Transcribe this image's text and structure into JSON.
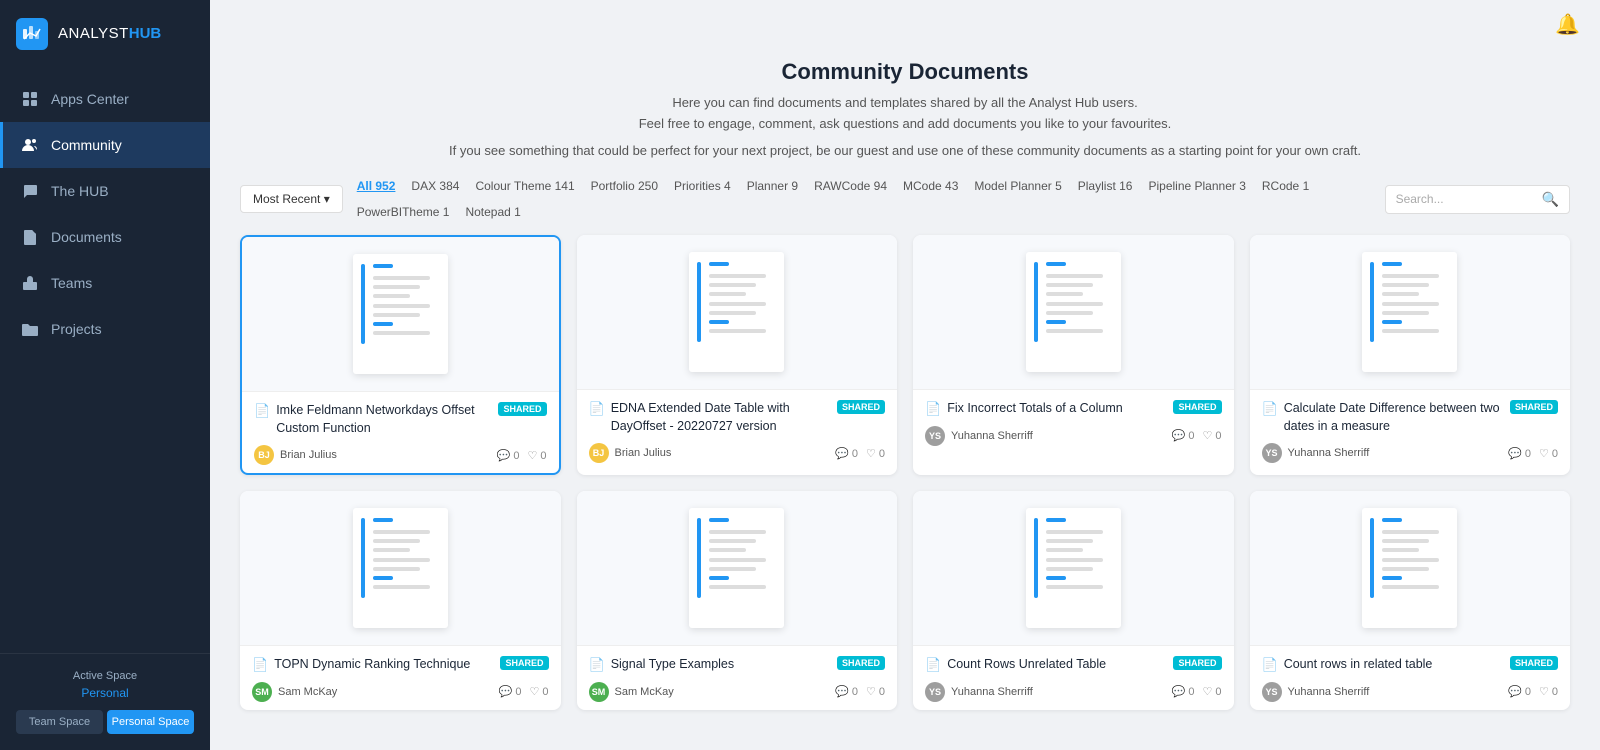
{
  "sidebar": {
    "logo": {
      "text_analyst": "ANALYST",
      "text_hub": "HUB"
    },
    "items": [
      {
        "id": "apps-center",
        "label": "Apps Center",
        "icon": "grid"
      },
      {
        "id": "community",
        "label": "Community",
        "icon": "users",
        "active": true
      },
      {
        "id": "the-hub",
        "label": "The HUB",
        "icon": "chat"
      },
      {
        "id": "documents",
        "label": "Documents",
        "icon": "doc"
      },
      {
        "id": "teams",
        "label": "Teams",
        "icon": "team"
      },
      {
        "id": "projects",
        "label": "Projects",
        "icon": "folder"
      }
    ],
    "active_space": {
      "label": "Active Space",
      "value": "Personal",
      "team_btn": "Team Space",
      "personal_btn": "Personal Space"
    }
  },
  "header": {
    "title": "Community Documents",
    "line1": "Here you can find documents and templates shared by all the Analyst Hub users.",
    "line2": "Feel free to engage, comment, ask questions and add documents you like to your favourites.",
    "line3": "If you see something that could be perfect for your next project, be our guest and use one of these community documents as a starting point for your own craft."
  },
  "filter_bar": {
    "most_recent_btn": "Most Recent ▾",
    "search_placeholder": "Search...",
    "tags": [
      {
        "label": "All 952",
        "active": true
      },
      {
        "label": "DAX 384",
        "active": false
      },
      {
        "label": "Colour Theme 141",
        "active": false
      },
      {
        "label": "Portfolio 250",
        "active": false
      },
      {
        "label": "Priorities 4",
        "active": false
      },
      {
        "label": "Planner 9",
        "active": false
      },
      {
        "label": "RAWCode 94",
        "active": false
      },
      {
        "label": "MCode 43",
        "active": false
      },
      {
        "label": "Model Planner 5",
        "active": false
      },
      {
        "label": "Playlist 16",
        "active": false
      },
      {
        "label": "Pipeline Planner 3",
        "active": false
      },
      {
        "label": "RCode 1",
        "active": false
      },
      {
        "label": "PowerBITheme 1",
        "active": false
      },
      {
        "label": "Notepad 1",
        "active": false
      }
    ]
  },
  "documents": [
    {
      "id": 1,
      "title": "Imke Feldmann Networkdays Offset Custom Function",
      "shared": true,
      "selected": true,
      "author": "Brian Julius",
      "avatar_color": "#f4c542",
      "avatar_initials": "BJ",
      "comments": 0,
      "likes": 0
    },
    {
      "id": 2,
      "title": "EDNA Extended Date Table with DayOffset - 20220727 version",
      "shared": true,
      "selected": false,
      "author": "Brian Julius",
      "avatar_color": "#f4c542",
      "avatar_initials": "BJ",
      "comments": 0,
      "likes": 0
    },
    {
      "id": 3,
      "title": "Fix Incorrect Totals of a Column",
      "shared": true,
      "selected": false,
      "author": "Yuhanna Sherriff",
      "avatar_color": "#9e9e9e",
      "avatar_initials": "YS",
      "comments": 0,
      "likes": 0
    },
    {
      "id": 4,
      "title": "Calculate Date Difference between two dates in a measure",
      "shared": true,
      "selected": false,
      "author": "Yuhanna Sherriff",
      "avatar_color": "#9e9e9e",
      "avatar_initials": "YS",
      "comments": 0,
      "likes": 0
    },
    {
      "id": 5,
      "title": "TOPN Dynamic Ranking Technique",
      "shared": true,
      "selected": false,
      "author": "Sam McKay",
      "avatar_color": "#4caf50",
      "avatar_initials": "SM",
      "comments": 0,
      "likes": 0
    },
    {
      "id": 6,
      "title": "Signal Type Examples",
      "shared": true,
      "selected": false,
      "author": "Sam McKay",
      "avatar_color": "#4caf50",
      "avatar_initials": "SM",
      "comments": 0,
      "likes": 0
    },
    {
      "id": 7,
      "title": "Count Rows Unrelated Table",
      "shared": true,
      "selected": false,
      "author": "Yuhanna Sherriff",
      "avatar_color": "#9e9e9e",
      "avatar_initials": "YS",
      "comments": 0,
      "likes": 0
    },
    {
      "id": 8,
      "title": "Count rows in related table",
      "shared": true,
      "selected": false,
      "author": "Yuhanna Sherriff",
      "avatar_color": "#9e9e9e",
      "avatar_initials": "YS",
      "comments": 0,
      "likes": 0
    }
  ],
  "shared_badge_label": "SHARED",
  "bell_icon": "🔔"
}
